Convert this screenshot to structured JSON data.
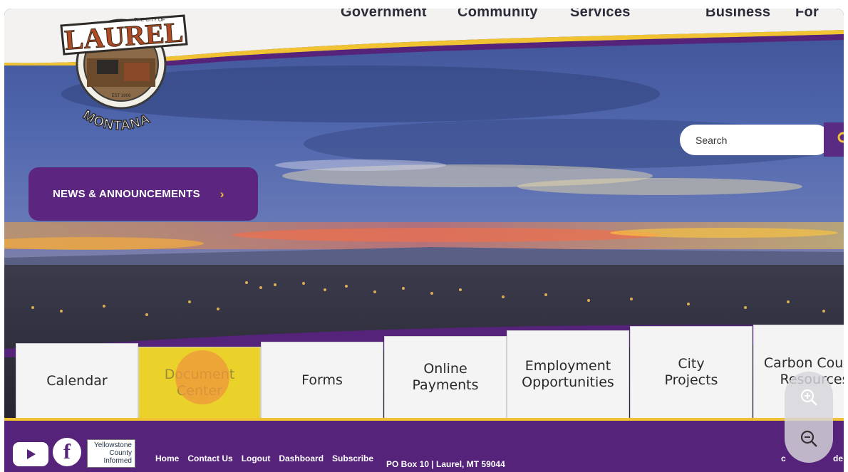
{
  "nav": {
    "items": [
      "Government",
      "Community",
      "Services",
      "Business",
      "For"
    ]
  },
  "logo": {
    "top_text": "THE CITY OF",
    "name": "LAUREL",
    "est": "EST 1908",
    "state": "MONTANA"
  },
  "search": {
    "placeholder": "Search"
  },
  "news": {
    "label": "NEWS & ANNOUNCEMENTS",
    "chevron": "›"
  },
  "tiles": [
    "Calendar",
    "Document\nCenter",
    "Forms",
    "Online\nPayments",
    "Employment\nOpportunities",
    "City\nProjects",
    "Carbon County\nResources"
  ],
  "footer": {
    "yci_label": "Yellowstone County Informed",
    "links": [
      "Home",
      "Contact Us",
      "Logout",
      "Dashboard",
      "Subscribe"
    ],
    "address": "PO Box 10 | Laurel, MT 59044",
    "right_a": "c",
    "right_b": "de"
  },
  "colors": {
    "brand_purple": "#5c2680",
    "accent_gold": "#f1c232",
    "highlight": "#ead22a"
  },
  "icons": [
    "search-icon",
    "youtube-icon",
    "facebook-icon",
    "zoom-in-icon",
    "zoom-out-icon",
    "chevron-right-icon"
  ]
}
